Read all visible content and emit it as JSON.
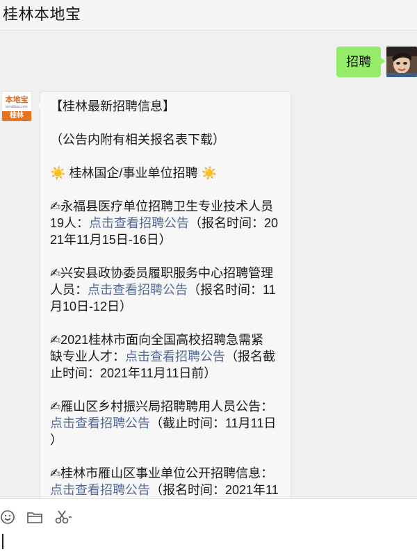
{
  "window": {
    "title": "桂林本地宝"
  },
  "outgoing": {
    "text": "招聘"
  },
  "official_avatar": {
    "logo_text": "本地宝",
    "url_text": "bendibao.com",
    "city_text": "桂林"
  },
  "message": {
    "header": "【桂林最新招聘信息】",
    "note": "（公告内附有相关报名表下载）",
    "section_title": "桂林国企/事业单位招聘",
    "link_text": "点击查看招聘公告",
    "items": [
      {
        "lines": [
          [
            "✍永福县医疗单位招聘卫生专业技术人员"
          ],
          [
            "19人：",
            "LINK",
            "（报名时间：20"
          ],
          [
            "21年11月15日-16日）"
          ]
        ]
      },
      {
        "lines": [
          [
            "✍兴安县政协委员履职服务中心招聘管理"
          ],
          [
            "人员：",
            "LINK",
            "（报名时间：11"
          ],
          [
            "月10日-12日）"
          ]
        ]
      },
      {
        "lines": [
          [
            "✍2021桂林市面向全国高校招聘急需紧"
          ],
          [
            "缺专业人才：",
            "LINK",
            "（报名截"
          ],
          [
            "止时间：2021年11月11日前）"
          ]
        ]
      },
      {
        "lines": [
          [
            "✍雁山区乡村振兴局招聘聘用人员公告："
          ],
          [
            "LINK",
            "（截止时间：11月11日"
          ],
          [
            "）"
          ]
        ]
      },
      {
        "lines": [
          [
            "✍桂林市雁山区事业单位公开招聘信息："
          ],
          [
            "LINK",
            "（报名时间：2021年11"
          ]
        ]
      }
    ]
  },
  "toolbar": {
    "icons": [
      "smiley-icon",
      "folder-icon",
      "scissors-icon"
    ]
  },
  "colors": {
    "bubble_out": "#95ec69",
    "link": "#576b95",
    "accent": "#e8731e"
  }
}
